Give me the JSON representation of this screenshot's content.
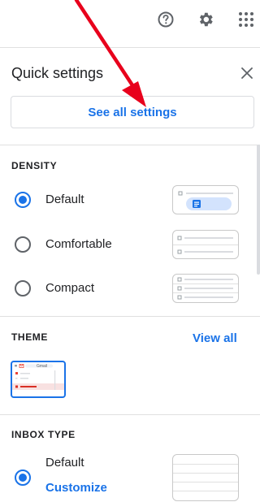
{
  "toolbar": {
    "help_icon": "help-circle-icon",
    "settings_icon": "gear-icon",
    "apps_icon": "apps-grid-icon"
  },
  "panel": {
    "title": "Quick settings",
    "close_icon": "close-icon",
    "see_all_label": "See all settings"
  },
  "density": {
    "label": "DENSITY",
    "options": [
      {
        "label": "Default",
        "selected": true
      },
      {
        "label": "Comfortable",
        "selected": false
      },
      {
        "label": "Compact",
        "selected": false
      }
    ]
  },
  "theme": {
    "label": "THEME",
    "view_all_label": "View all",
    "thumbnail_text": "Gmail"
  },
  "inbox_type": {
    "label": "INBOX TYPE",
    "option": {
      "label": "Default",
      "selected": true
    },
    "customize_label": "Customize"
  },
  "colors": {
    "accent": "#1a73e8",
    "annotation_arrow": "#e8001c",
    "divider": "#e0e0e0"
  }
}
